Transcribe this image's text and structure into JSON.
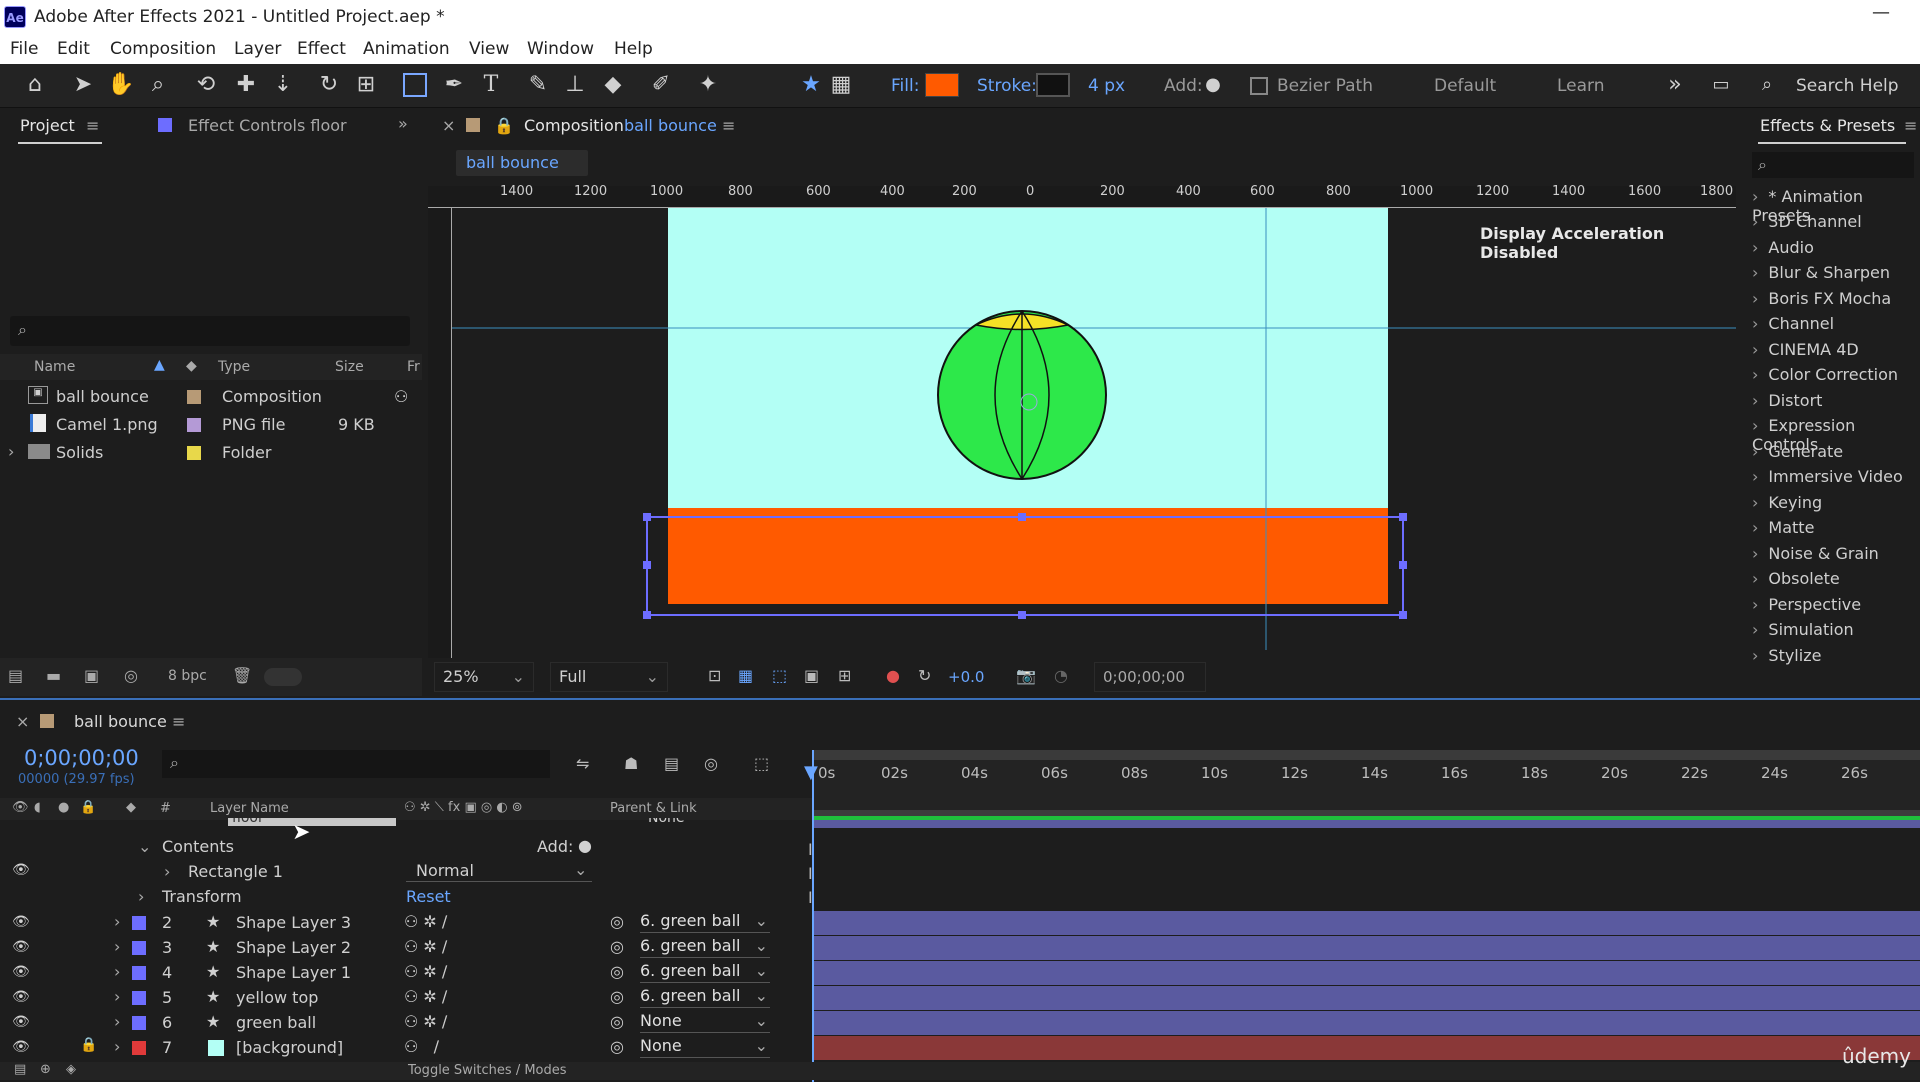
{
  "app": {
    "title": "Adobe After Effects 2021 - Untitled Project.aep *",
    "logo": "Ae"
  },
  "menu": [
    "File",
    "Edit",
    "Composition",
    "Layer",
    "Effect",
    "Animation",
    "View",
    "Window",
    "Help"
  ],
  "toolbar": {
    "fill_label": "Fill:",
    "stroke_label": "Stroke:",
    "stroke_width": "4 px",
    "add_label": "Add:",
    "bezier_label": "Bezier Path",
    "workspace_default": "Default",
    "workspace_learn": "Learn",
    "search_help": "Search Help",
    "fill_color": "#ff5a00"
  },
  "project_panel": {
    "tab": "Project",
    "tab2": "Effect Controls floor",
    "headers": {
      "name": "Name",
      "type": "Type",
      "size": "Size",
      "fr": "Fr"
    },
    "items": [
      {
        "name": "ball bounce",
        "type": "Composition",
        "size": "",
        "chip": "#b79a76"
      },
      {
        "name": "Camel 1.png",
        "type": "PNG file",
        "size": "9 KB",
        "chip": "#b49ad6"
      },
      {
        "name": "Solids",
        "type": "Folder",
        "size": "",
        "chip": "#e8d84a"
      }
    ],
    "bpc": "8 bpc"
  },
  "composition": {
    "tab_label": "Composition",
    "comp_name": "ball bounce",
    "chip_label": "ball bounce",
    "display_msg": "Display Acceleration Disabled",
    "ruler": [
      "1400",
      "1200",
      "1000",
      "800",
      "600",
      "400",
      "200",
      "0",
      "200",
      "400",
      "600",
      "800",
      "1000",
      "1200",
      "1400",
      "1600",
      "1800"
    ],
    "zoom": "25%",
    "resolution": "Full",
    "exposure": "+0.0",
    "timecode": "0;00;00;00",
    "bg_color": "#b3fff5",
    "floor_color": "#ff5a00",
    "ball_color": "#2de84a",
    "top_color": "#f5e126"
  },
  "effects": {
    "title": "Effects & Presets",
    "items": [
      "* Animation Presets",
      "3D Channel",
      "Audio",
      "Blur & Sharpen",
      "Boris FX Mocha",
      "Channel",
      "CINEMA 4D",
      "Color Correction",
      "Distort",
      "Expression Controls",
      "Generate",
      "Immersive Video",
      "Keying",
      "Matte",
      "Noise & Grain",
      "Obsolete",
      "Perspective",
      "Simulation",
      "Stylize"
    ]
  },
  "timeline": {
    "comp_name": "ball bounce",
    "timecode": "0;00;00;00",
    "fps": "00000 (29.97 fps)",
    "col_layer_name": "Layer Name",
    "col_parent": "Parent & Link",
    "col_num": "#",
    "ticks": [
      "0s",
      "02s",
      "04s",
      "06s",
      "08s",
      "10s",
      "12s",
      "14s",
      "16s",
      "18s",
      "20s",
      "22s",
      "24s",
      "26s"
    ],
    "floor_hint": "floor",
    "contents_label": "Contents",
    "add_label": "Add:",
    "rect_label": "Rectangle 1",
    "blend_mode": "Normal",
    "transform_label": "Transform",
    "reset_label": "Reset",
    "layers": [
      {
        "num": "2",
        "name": "Shape Layer 3",
        "parent": "6. green ball",
        "chip": "#6d6dff"
      },
      {
        "num": "3",
        "name": "Shape Layer 2",
        "parent": "6. green ball",
        "chip": "#6d6dff"
      },
      {
        "num": "4",
        "name": "Shape Layer 1",
        "parent": "6. green ball",
        "chip": "#6d6dff"
      },
      {
        "num": "5",
        "name": "yellow top",
        "parent": "6. green ball",
        "chip": "#6d6dff"
      },
      {
        "num": "6",
        "name": "green ball",
        "parent": "None",
        "chip": "#6d6dff"
      },
      {
        "num": "7",
        "name": "[background]",
        "parent": "None",
        "chip": "#e03a3a"
      }
    ],
    "parent_none": "None",
    "toggle_label": "Toggle Switches / Modes"
  },
  "watermark": "ûdemy"
}
